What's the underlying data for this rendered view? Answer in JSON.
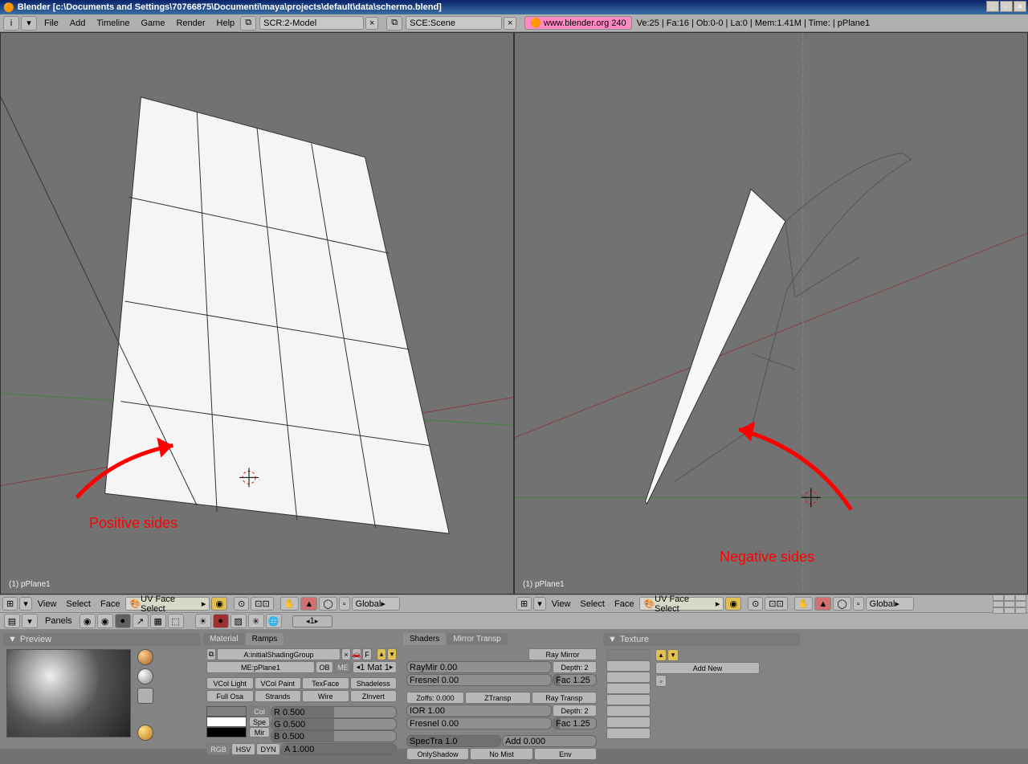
{
  "title": "Blender [c:\\Documents and Settings\\70766875\\Documenti\\maya\\projects\\default\\data\\schermo.blend]",
  "menu": {
    "file": "File",
    "add": "Add",
    "timeline": "Timeline",
    "game": "Game",
    "render": "Render",
    "help": "Help",
    "scr": "SCR:2-Model",
    "sce": "SCE:Scene",
    "link": "www.blender.org 240",
    "stats": "Ve:25 | Fa:16 | Ob:0-0 | La:0 | Mem:1.41M | Time:  | pPlane1"
  },
  "viewport": {
    "left_label": "(1) pPlane1",
    "right_label": "(1) pPlane1",
    "annotation_left": "Positive sides",
    "annotation_right": "Negative sides",
    "view": "View",
    "select": "Select",
    "face": "Face",
    "uvmode": "UV Face Select",
    "global": "Global"
  },
  "panels_label": "Panels",
  "frame": "1",
  "panels": {
    "preview": "Preview",
    "material_tab": "Material",
    "ramps_tab": "Ramps",
    "shaders_tab": "Shaders",
    "mirror_tab": "Mirror Transp",
    "texture_tab": "Texture",
    "add_new": "Add New",
    "shading_group": "A:initialShadingGroup",
    "mesh_name": "ME:pPlane1",
    "ob": "OB",
    "me": "ME",
    "mat_count": "1 Mat 1",
    "vcol_light": "VCol Light",
    "vcol_paint": "VCol Paint",
    "texface": "TexFace",
    "shadeless": "Shadeless",
    "full_osa": "Full Osa",
    "strands": "Strands",
    "wire": "Wire",
    "zinvert": "ZInvert",
    "col": "Col",
    "spe": "Spe",
    "mir": "Mir",
    "r": "R 0.500",
    "g": "G 0.500",
    "b": "B 0.500",
    "rgb": "RGB",
    "hsv": "HSV",
    "dyn": "DYN",
    "a": "A 1.000",
    "ray_mirror": "Ray Mirror",
    "raymir": "RayMir 0.00",
    "depth2": "Depth: 2",
    "fresnel": "Fresnel 0.00",
    "fac": "Fac 1.25",
    "zoffs": "Zoffs: 0.000",
    "ztransp": "ZTransp",
    "ray_transp": "Ray Transp",
    "ior": "IOR 1.00",
    "fresnel2": "Fresnel 0.00",
    "fac2": "Fac 1.25",
    "spectra": "SpecTra 1.0",
    "add": "Add 0.000",
    "onlyshadow": "OnlyShadow",
    "nomist": "No Mist",
    "env": "Env"
  }
}
